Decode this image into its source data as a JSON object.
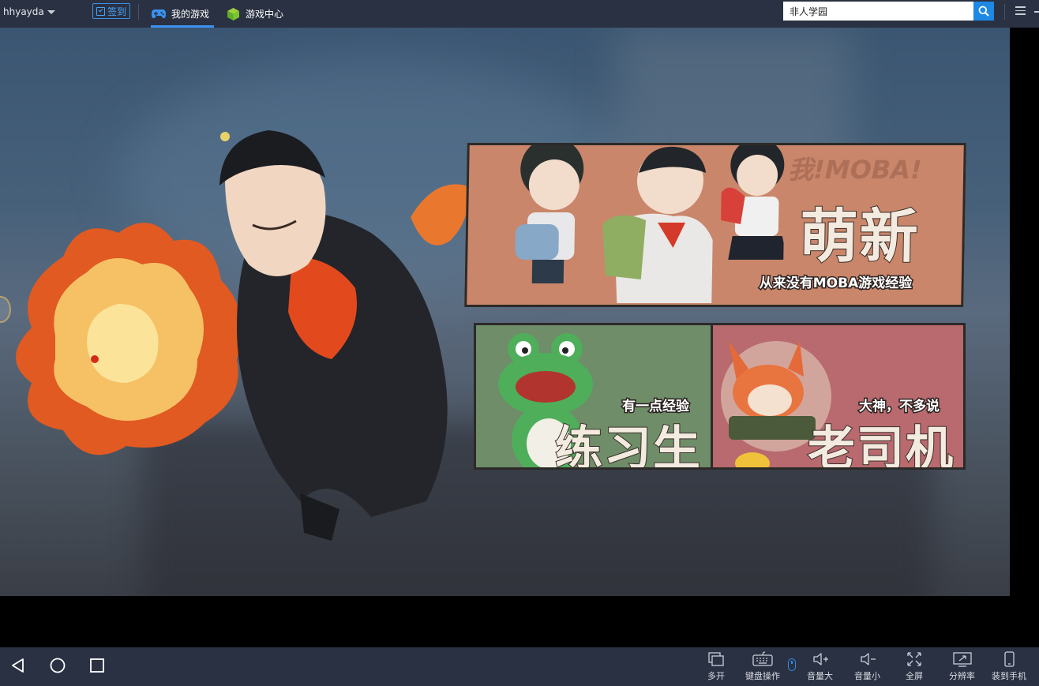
{
  "topbar": {
    "username": "hhyayda",
    "signin_label": "签到",
    "tabs": [
      {
        "label": "我的游戏",
        "icon": "gamepad-icon",
        "active": true
      },
      {
        "label": "游戏中心",
        "icon": "cube-icon",
        "active": false
      }
    ],
    "search": {
      "value": "非人学园",
      "placeholder": ""
    }
  },
  "game": {
    "cards": [
      {
        "title": "萌新",
        "subtitle": "从来没有MOBA游戏经验",
        "watermark": "我!MOBA!"
      },
      {
        "title": "练习生",
        "subtitle": "有一点经验"
      },
      {
        "title": "老司机",
        "subtitle": "大神，不多说"
      }
    ]
  },
  "bottombar": {
    "nav": [
      "back-icon",
      "home-icon",
      "recents-icon"
    ],
    "tools": [
      {
        "label": "多开",
        "icon": "multi-instance-icon"
      },
      {
        "label": "键盘操作",
        "icon": "keyboard-icon"
      },
      {
        "label": "音量大",
        "icon": "volume-up-icon"
      },
      {
        "label": "音量小",
        "icon": "volume-down-icon"
      },
      {
        "label": "全屏",
        "icon": "fullscreen-icon"
      },
      {
        "label": "分辨率",
        "icon": "resolution-icon"
      },
      {
        "label": "装到手机",
        "icon": "install-to-phone-icon"
      }
    ]
  },
  "colors": {
    "bar_bg": "#2a3142",
    "accent": "#1e88e5",
    "tab_underline": "#3a93f0",
    "card_newbie": "#c9866a",
    "card_trainee": "#6e8d68",
    "card_veteran": "#b86a6e"
  }
}
